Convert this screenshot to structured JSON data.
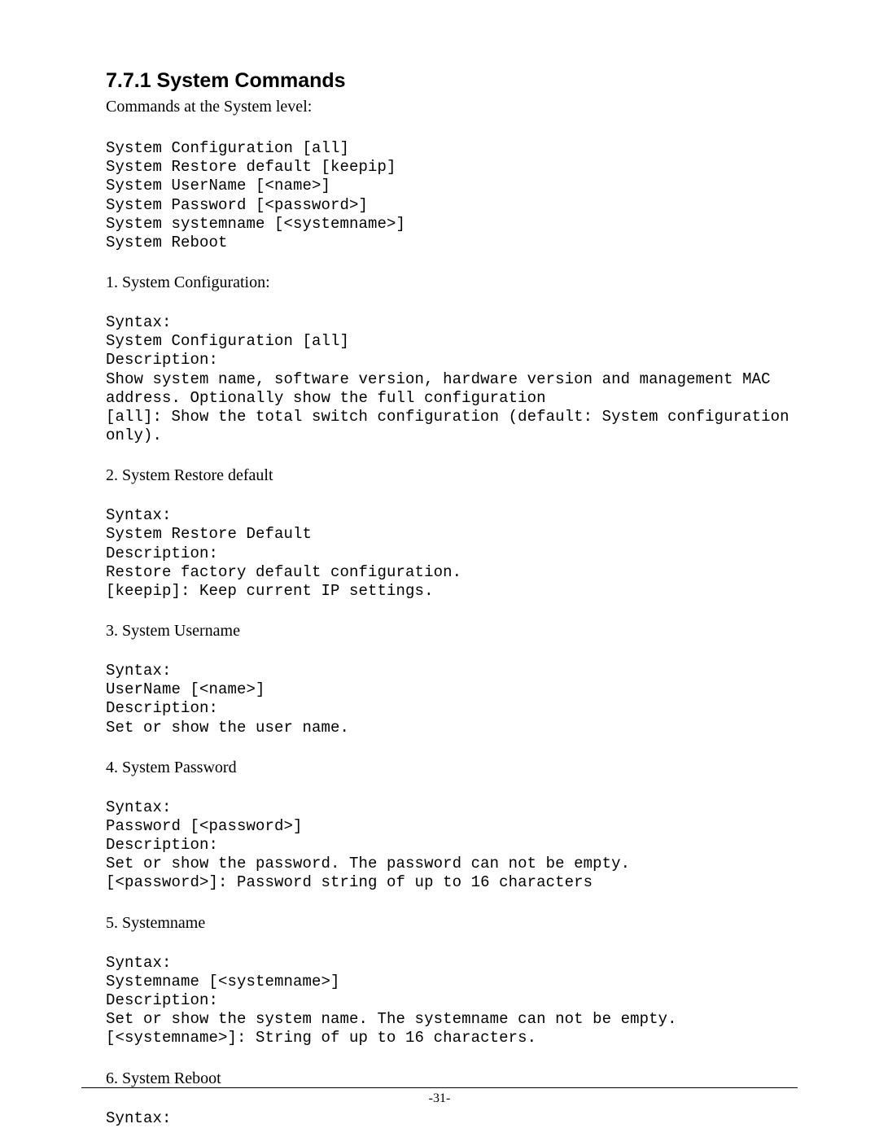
{
  "heading": "7.7.1 System Commands",
  "intro": "Commands at the System level:",
  "commands_block": "System Configuration [all]\nSystem Restore default [keepip]\nSystem UserName [<name>]\nSystem Password [<password>]\nSystem systemname [<systemname>]\nSystem Reboot",
  "items": [
    {
      "title": "1.  System Configuration:",
      "body": "Syntax:\nSystem Configuration [all]\nDescription:\nShow system name, software version, hardware version and management MAC\naddress. Optionally show the full configuration\n[all]: Show the total switch configuration (default: System configuration\nonly)."
    },
    {
      "title": "2.  System Restore default",
      "body": "Syntax:\nSystem Restore Default\nDescription:\nRestore factory default configuration.\n[keepip]: Keep current IP settings."
    },
    {
      "title": "3.  System Username",
      "body": "Syntax:\nUserName [<name>]\nDescription:\nSet or show the user name."
    },
    {
      "title": "4.  System Password",
      "body": "Syntax:\nPassword [<password>]\nDescription:\nSet or show the password. The password can not be empty.\n[<password>]: Password string of up to 16 characters"
    },
    {
      "title": "5.  Systemname",
      "body": "Syntax:\nSystemname [<systemname>]\nDescription:\nSet or show the system name. The systemname can not be empty.\n[<systemname>]: String of up to 16 characters."
    },
    {
      "title": "6.  System Reboot",
      "body": "Syntax:"
    }
  ],
  "page_number": "-31-"
}
